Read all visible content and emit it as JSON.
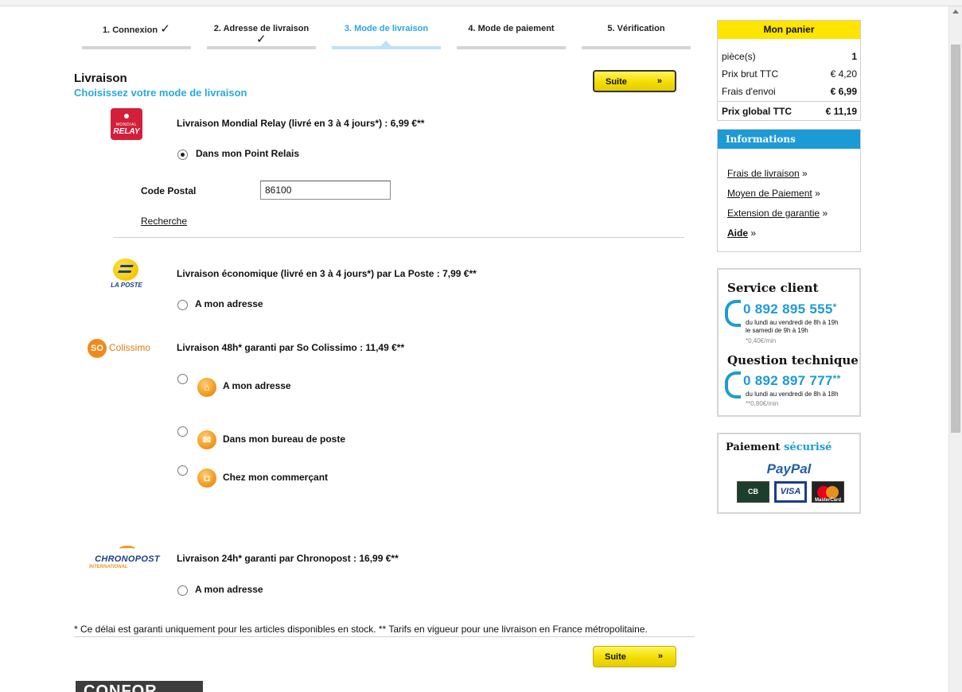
{
  "steps": [
    {
      "label": "1. Connexion",
      "done": "✓"
    },
    {
      "label": "2. Adresse de livraison",
      "done": "✓"
    },
    {
      "label": "3. Mode de livraison",
      "done": ""
    },
    {
      "label": "4. Mode de paiement",
      "done": ""
    },
    {
      "label": "5. Vérification",
      "done": ""
    }
  ],
  "page": {
    "title": "Livraison",
    "subtitle": "Choisissez votre mode de livraison",
    "next_label": "Suite",
    "next_arrow": "»"
  },
  "mondial_relay": {
    "logo_small": "MONDIAL",
    "logo_big": "RELAY",
    "title": "Livraison Mondial Relay (livré en 3 à 4 jours*) : 6,99 €**",
    "option": "Dans mon Point Relais",
    "postal_label": "Code Postal",
    "postal_value": "86100",
    "search_link": "Recherche"
  },
  "la_poste": {
    "logo_text": "LA POSTE",
    "title": "Livraison économique (livré en 3 à 4 jours*) par La Poste : 7,99 €**",
    "option": "A mon adresse"
  },
  "colissimo": {
    "logo_so": "SO",
    "logo_name": "Colissimo",
    "title": "Livraison 48h* garanti par So Colissimo : 11,49 €**",
    "options": [
      "A mon adresse",
      "Dans mon bureau de poste",
      "Chez mon commerçant"
    ]
  },
  "chronopost": {
    "logo_name": "CHRONOPOST",
    "logo_intl": "INTERNATIONAL",
    "title": "Livraison 24h* garanti par Chronopost : 16,99 €**",
    "option": "A mon adresse"
  },
  "footnote": "* Ce délai est garanti uniquement pour les articles disponibles en stock. ** Tarifs en vigueur pour une livraison en France métropolitaine.",
  "cart": {
    "title": "Mon panier",
    "rows": [
      {
        "label": "pièce(s)",
        "value": "1"
      },
      {
        "label": "Prix brut TTC",
        "value": "€ 4,20"
      },
      {
        "label": "Frais d'envoi",
        "value": "€ 6,99"
      },
      {
        "label": "Prix global TTC",
        "value": "€ 11,19"
      }
    ]
  },
  "info": {
    "title": "Informations",
    "links": [
      "Frais de livraison",
      "Moyen de Paiement",
      "Extension de garantie",
      "Aide"
    ],
    "arrow": "»"
  },
  "service": {
    "title1": "Service client",
    "phone1": "0 892 895 555",
    "phone1_mark": "*",
    "hours1a": "du lundi au vendredi de 8h à 19h",
    "hours1b": "le samedi de 9h à 19h",
    "note1": "*0,40€/min",
    "title2": "Question technique",
    "phone2": "0 892 897 777",
    "phone2_mark": "**",
    "hours2": "du lundi au vendredi de 8h à 18h",
    "note2": "**0,80€/min"
  },
  "paiement": {
    "title_a": "Paiement",
    "title_b": "sécurisé",
    "paypal": "PayPal",
    "cards": [
      "CB",
      "VISA",
      "MasterCard"
    ]
  },
  "footer_logo": "CONFOR"
}
